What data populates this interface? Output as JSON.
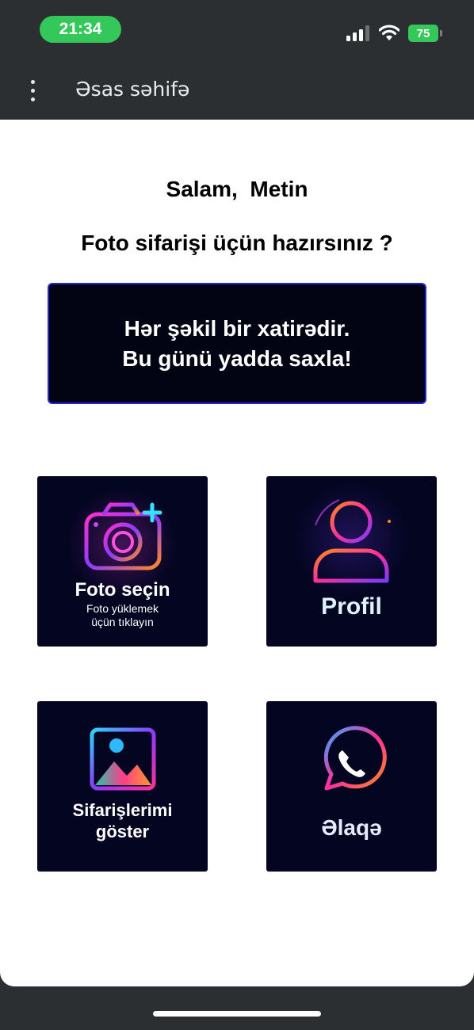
{
  "status_bar": {
    "time": "21:34",
    "battery": "75"
  },
  "app_bar": {
    "menu_icon": "more-vertical-icon",
    "title": "Əsas səhifə"
  },
  "main": {
    "greeting": "Salam,  Metin",
    "question": "Foto sifarişi üçün hazırsınız ?",
    "banner": {
      "line1": "Hər şəkil bir xatirədir.",
      "line2": "Bu günü yadda saxla!"
    },
    "tiles": [
      {
        "icon": "camera-plus-icon",
        "label": "Foto seçin",
        "sub1": "Foto yüklemek",
        "sub2": "üçün tıklayın"
      },
      {
        "icon": "user-icon",
        "label": "Profil"
      },
      {
        "icon": "image-gallery-icon",
        "label1": "Sifarişlerimi",
        "label2": "göster"
      },
      {
        "icon": "whatsapp-icon",
        "label": "Əlaqə"
      }
    ]
  },
  "colors": {
    "accent_green": "#34c759",
    "banner_border": "#2424d8",
    "tile_bg": "#030521"
  }
}
